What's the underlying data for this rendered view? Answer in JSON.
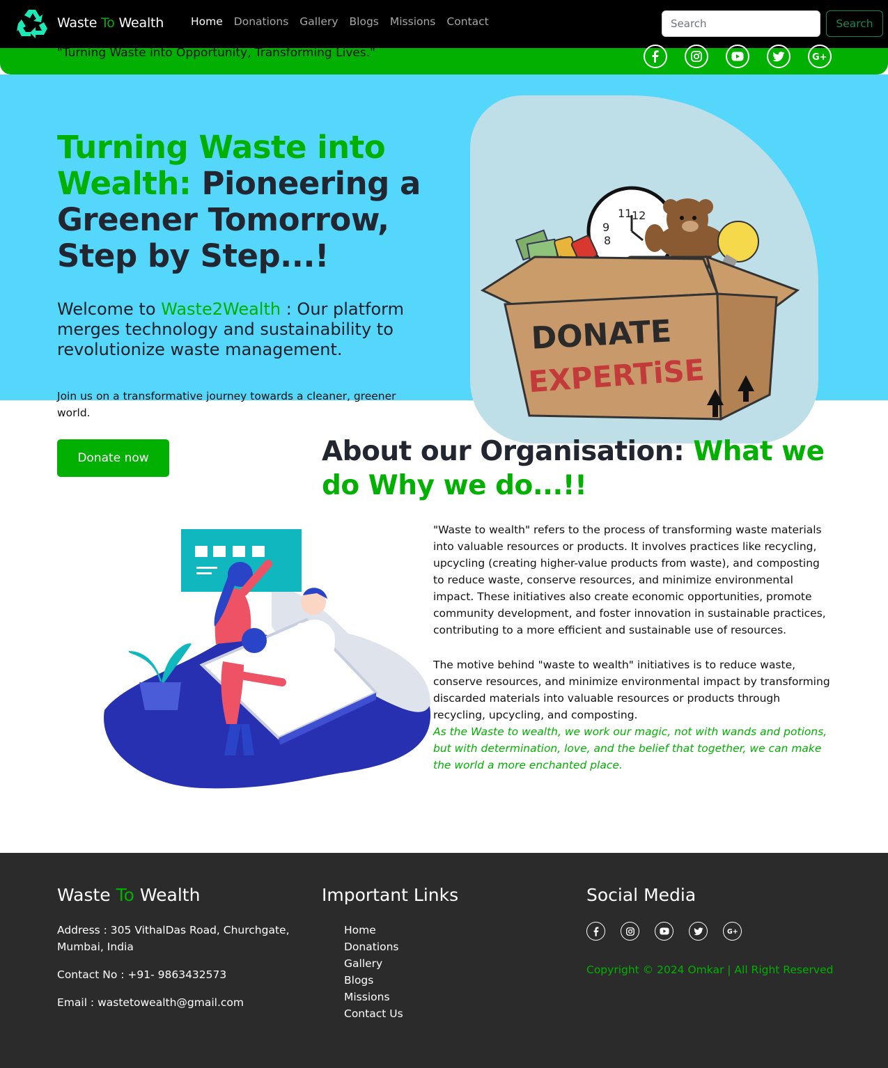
{
  "nav": {
    "brand_prefix": "Waste ",
    "brand_to": "To",
    "brand_suffix": " Wealth",
    "links": [
      "Home",
      "Donations",
      "Gallery",
      "Blogs",
      "Missions",
      "Contact"
    ],
    "search_placeholder": "Search",
    "search_button": "Search"
  },
  "strip": {
    "tagline": "\"Turning Waste into Opportunity, Transforming Lives.\"",
    "social_icons": [
      "facebook-icon",
      "instagram-icon",
      "youtube-icon",
      "twitter-icon",
      "google-plus-icon"
    ]
  },
  "hero": {
    "title_green": "Turning Waste into Wealth:",
    "title_dark": " Pioneering a Greener Tomorrow, Step by Step...!",
    "sub_prefix": "Welcome to ",
    "sub_brand": "Waste2Wealth",
    "sub_suffix": " : Our platform merges technology and sustainability to revolutionize waste management.",
    "join": "Join us on a transformative journey towards a cleaner, greener world.",
    "donate_button": "Donate now",
    "box_text_1": "DONATE",
    "box_text_2": "EXPERTiSE"
  },
  "about": {
    "title_dark": "About our Organisation: ",
    "title_green": "What we do Why we do...!!",
    "para1": "\"Waste to wealth\" refers to the process of transforming waste materials into valuable resources or products. It involves practices like recycling, upcycling (creating higher-value products from waste), and composting to reduce waste, conserve resources, and minimize environmental impact. These initiatives also create economic opportunities, promote community development, and foster innovation in sustainable practices, contributing to a more efficient and sustainable use of resources.",
    "para2": "The motive behind \"waste to wealth\" initiatives is to reduce waste, conserve resources, and minimize environmental impact by transforming discarded materials into valuable resources or products through recycling, upcycling, and composting.",
    "italic": "As the Waste to wealth, we work our magic, not with wands and potions, but with determination, love, and the belief that together, we can make the world a more enchanted place."
  },
  "footer": {
    "brand_prefix": "Waste ",
    "brand_to": "To",
    "brand_suffix": " Wealth",
    "address": "Address : 305 VithalDas Road, Churchgate, Mumbai, India",
    "contact": "Contact No : +91- 9863432573",
    "email": "Email : wastetowealth@gmail.com",
    "links_title": "Important Links",
    "links": [
      "Home",
      "Donations",
      "Gallery",
      "Blogs",
      "Missions",
      "Contact Us"
    ],
    "social_title": "Social Media",
    "copyright": "Copyright © 2024 Omkar | All Right Reserved"
  },
  "colors": {
    "brand_green": "#02b002",
    "hero_blue": "#55d7fc",
    "footer_bg": "#2b2b2b",
    "logo_teal": "#1de9b6"
  }
}
